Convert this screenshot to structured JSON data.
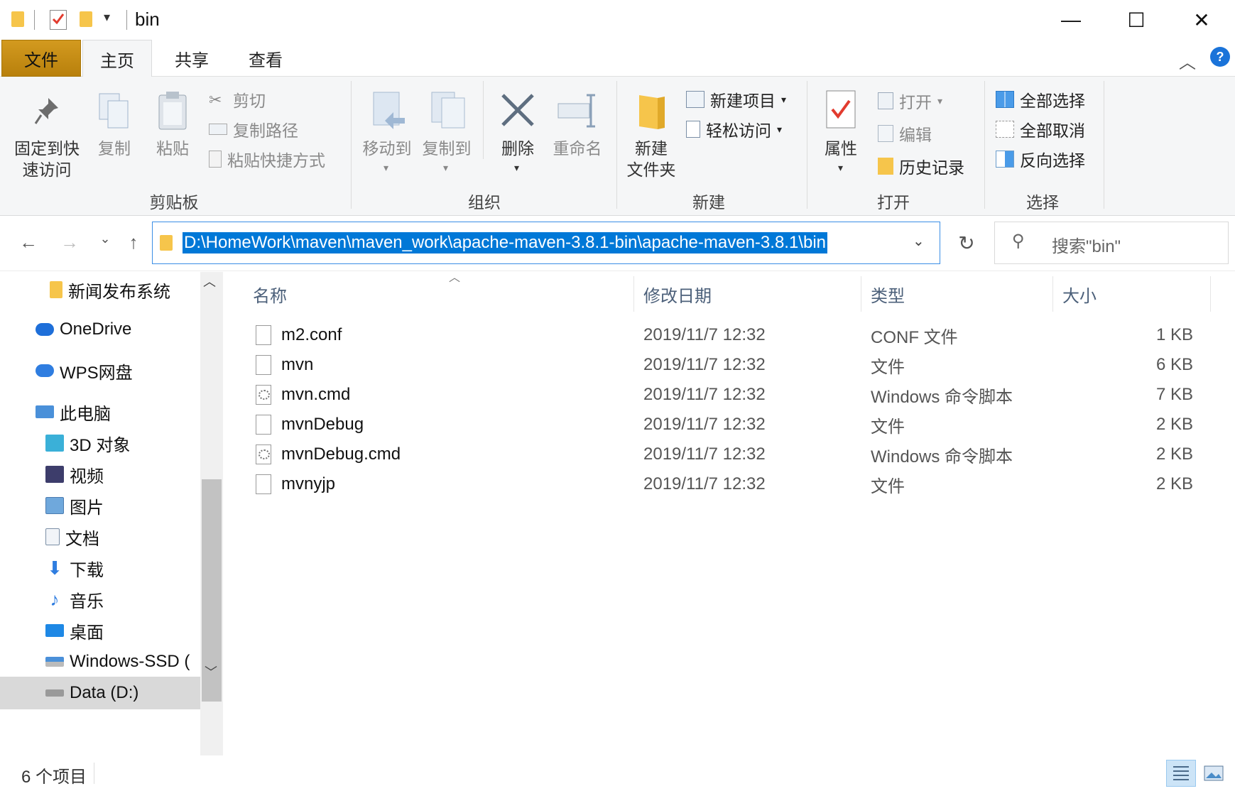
{
  "window": {
    "title": "bin",
    "controls": {
      "minimize": "—",
      "maximize": "☐",
      "close": "✕"
    }
  },
  "ribbon_tabs": [
    "文件",
    "主页",
    "共享",
    "查看"
  ],
  "ribbon": {
    "clipboard": {
      "group_label": "剪贴板",
      "pin_label_1": "固定到快",
      "pin_label_2": "速访问",
      "copy": "复制",
      "paste": "粘贴",
      "cut": "剪切",
      "copy_path": "复制路径",
      "paste_shortcut": "粘贴快捷方式"
    },
    "organize": {
      "group_label": "组织",
      "move_to": "移动到",
      "copy_to": "复制到",
      "delete": "删除",
      "rename": "重命名"
    },
    "new": {
      "group_label": "新建",
      "new_folder_1": "新建",
      "new_folder_2": "文件夹",
      "new_item": "新建项目",
      "easy_access": "轻松访问"
    },
    "open": {
      "group_label": "打开",
      "properties": "属性",
      "open": "打开",
      "edit": "编辑",
      "history": "历史记录"
    },
    "select": {
      "group_label": "选择",
      "select_all": "全部选择",
      "select_none": "全部取消",
      "invert": "反向选择"
    }
  },
  "address": {
    "path": "D:\\HomeWork\\maven\\maven_work\\apache-maven-3.8.1-bin\\apache-maven-3.8.1\\bin",
    "search_placeholder": "搜索\"bin\""
  },
  "nav_pane": {
    "items": [
      {
        "label": "新闻发布系统",
        "icon": "folder-icon"
      },
      {
        "label": "OneDrive",
        "icon": "onedrive-icon"
      },
      {
        "label": "WPS网盘",
        "icon": "wps-cloud-icon"
      },
      {
        "label": "此电脑",
        "icon": "computer-icon"
      },
      {
        "label": "3D 对象",
        "icon": "3d-objects-icon"
      },
      {
        "label": "视频",
        "icon": "video-icon"
      },
      {
        "label": "图片",
        "icon": "pictures-icon"
      },
      {
        "label": "文档",
        "icon": "documents-icon"
      },
      {
        "label": "下载",
        "icon": "download-icon"
      },
      {
        "label": "音乐",
        "icon": "music-icon"
      },
      {
        "label": "桌面",
        "icon": "desktop-icon"
      },
      {
        "label": "Windows-SSD (",
        "icon": "windows-drive-icon"
      },
      {
        "label": "Data (D:)",
        "icon": "drive-icon"
      }
    ]
  },
  "file_list": {
    "columns": [
      "名称",
      "修改日期",
      "类型",
      "大小"
    ],
    "rows": [
      {
        "name": "m2.conf",
        "date": "2019/11/7 12:32",
        "type": "CONF 文件",
        "size": "1 KB",
        "icon": "file-icon"
      },
      {
        "name": "mvn",
        "date": "2019/11/7 12:32",
        "type": "文件",
        "size": "6 KB",
        "icon": "file-icon"
      },
      {
        "name": "mvn.cmd",
        "date": "2019/11/7 12:32",
        "type": "Windows 命令脚本",
        "size": "7 KB",
        "icon": "cmd-script-icon"
      },
      {
        "name": "mvnDebug",
        "date": "2019/11/7 12:32",
        "type": "文件",
        "size": "2 KB",
        "icon": "file-icon"
      },
      {
        "name": "mvnDebug.cmd",
        "date": "2019/11/7 12:32",
        "type": "Windows 命令脚本",
        "size": "2 KB",
        "icon": "cmd-script-icon"
      },
      {
        "name": "mvnyjp",
        "date": "2019/11/7 12:32",
        "type": "文件",
        "size": "2 KB",
        "icon": "file-icon"
      }
    ]
  },
  "status": {
    "item_count": "6 个项目"
  },
  "colors": {
    "accent": "#0078d7",
    "file_tab": "#c78a12",
    "folder": "#f6c54b"
  }
}
